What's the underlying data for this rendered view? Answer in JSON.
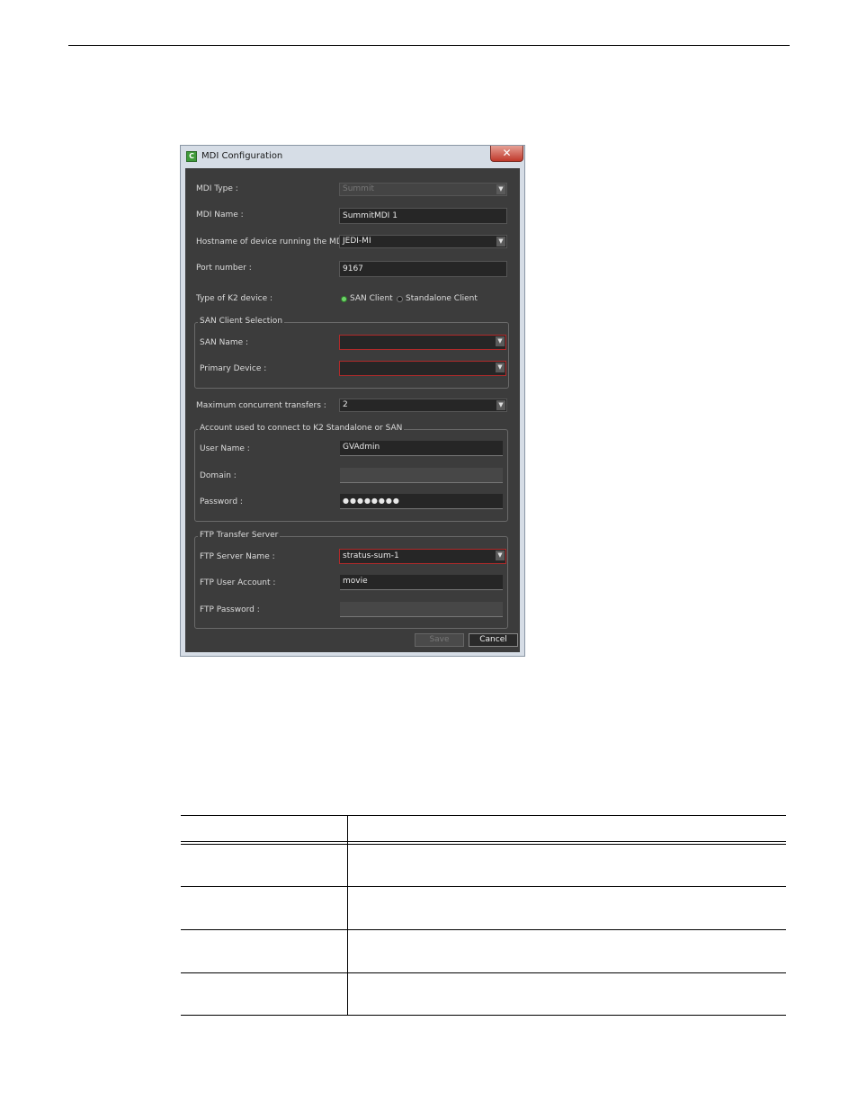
{
  "window": {
    "title": "MDI Configuration",
    "icon": "C",
    "close_glyph": "✕"
  },
  "form": {
    "mdi_type": {
      "label": "MDI Type :",
      "value": "Summit"
    },
    "mdi_name": {
      "label": "MDI Name :",
      "value": "SummitMDI 1"
    },
    "hostname": {
      "label": "Hostname of device running the MDI :",
      "value": "JEDI-MI"
    },
    "port": {
      "label": "Port number :",
      "value": "9167"
    },
    "k2_type": {
      "label": "Type of K2 device :",
      "option_san": "SAN Client",
      "option_standalone": "Standalone Client",
      "selected": "SAN Client"
    },
    "san_group": {
      "title": "SAN Client Selection",
      "san_name": {
        "label": "SAN Name :",
        "value": ""
      },
      "primary_device": {
        "label": "Primary Device :",
        "value": ""
      }
    },
    "max_transfers": {
      "label": "Maximum concurrent transfers :",
      "value": "2"
    },
    "account_group": {
      "title": "Account used to connect to K2 Standalone or SAN",
      "user_name": {
        "label": "User Name :",
        "value": "GVAdmin"
      },
      "domain": {
        "label": "Domain :",
        "value": ""
      },
      "password": {
        "label": "Password :",
        "value": "●●●●●●●●"
      }
    },
    "ftp_group": {
      "title": "FTP Transfer Server",
      "server_name": {
        "label": "FTP Server Name :",
        "value": "stratus-sum-1"
      },
      "user_account": {
        "label": "FTP User Account :",
        "value": "movie"
      },
      "password": {
        "label": "FTP Password :",
        "value": ""
      }
    },
    "buttons": {
      "save": "Save",
      "cancel": "Cancel"
    }
  },
  "colors": {
    "dialog_background": "#3c3c3c",
    "invalid_field_border": "#b02a2a",
    "radio_selected": "#6fd36a"
  }
}
